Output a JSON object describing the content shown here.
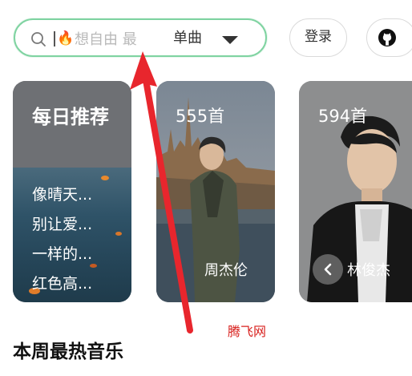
{
  "search": {
    "placeholder": "想自由 最",
    "type_label": "单曲"
  },
  "header": {
    "login_label": "登录"
  },
  "cards": {
    "daily": {
      "title": "每日推荐",
      "items": [
        "像晴天...",
        "别让爱...",
        "一样的...",
        "红色高..."
      ]
    },
    "jay": {
      "count": "555首",
      "artist": "周杰伦"
    },
    "jj": {
      "count": "594首",
      "artist": "林俊杰"
    }
  },
  "watermark": "腾飞网",
  "section": {
    "title": "本周最热音乐"
  },
  "colors": {
    "search_border": "#7fd3a1",
    "annotation_arrow": "#e8262d",
    "watermark": "#d8211e"
  }
}
